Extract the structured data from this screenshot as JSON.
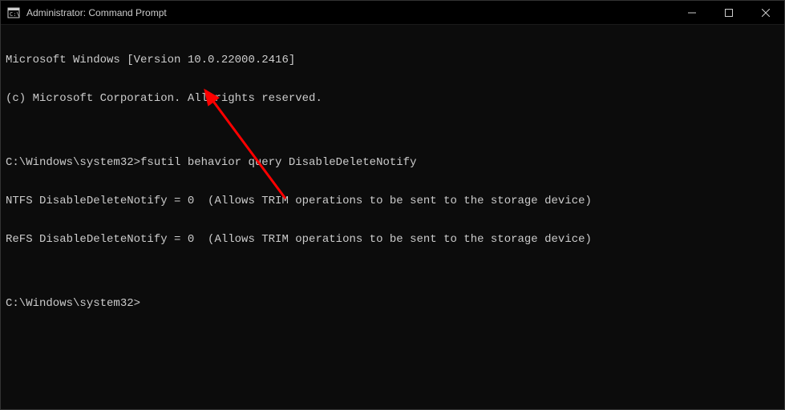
{
  "window": {
    "title": "Administrator: Command Prompt"
  },
  "terminal": {
    "lines": [
      "Microsoft Windows [Version 10.0.22000.2416]",
      "(c) Microsoft Corporation. All rights reserved.",
      "",
      "C:\\Windows\\system32>fsutil behavior query DisableDeleteNotify",
      "NTFS DisableDeleteNotify = 0  (Allows TRIM operations to be sent to the storage device)",
      "ReFS DisableDeleteNotify = 0  (Allows TRIM operations to be sent to the storage device)",
      "",
      "C:\\Windows\\system32>"
    ]
  },
  "annotation": {
    "color": "#ff0000"
  }
}
